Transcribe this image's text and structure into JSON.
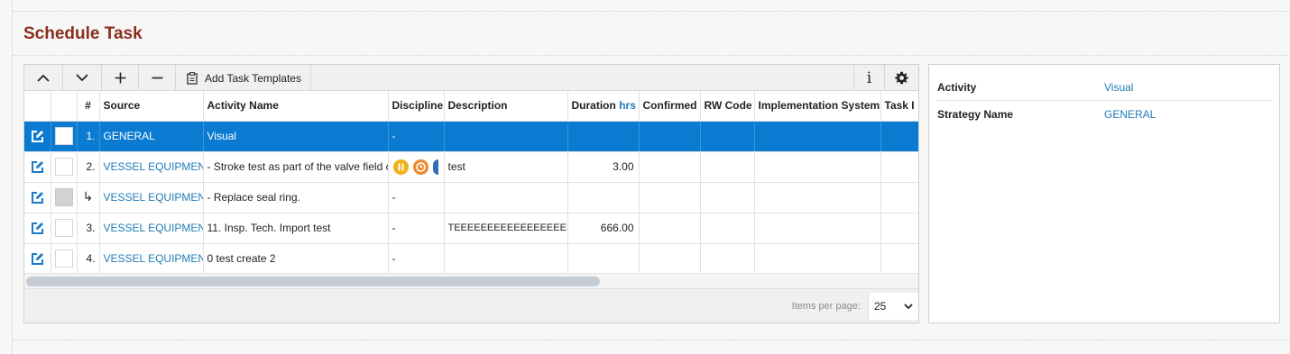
{
  "page": {
    "title": "Schedule Task"
  },
  "toolbar": {
    "add_task_templates_label": "Add Task Templates",
    "info_label": "i"
  },
  "grid": {
    "columns": {
      "num": "#",
      "source": "Source",
      "activity_name": "Activity Name",
      "discipline": "Discipline",
      "description": "Description",
      "duration": "Duration",
      "duration_unit": "hrs",
      "confirmed": "Confirmed",
      "rw_code": "RW Code",
      "implementation_system": "Implementation System",
      "task": "Task I"
    },
    "rows": [
      {
        "num": "1.",
        "source": "GENERAL",
        "activity_name": "Visual",
        "discipline": "-",
        "description": "",
        "duration": "",
        "selected": true
      },
      {
        "num": "2.",
        "source": "VESSEL EQUIPMENT",
        "activity_name": "- Stroke test as part of the valve field co",
        "discipline": "",
        "description": "test",
        "duration": "3.00"
      },
      {
        "num": "↳",
        "source": "VESSEL EQUIPMENT",
        "activity_name": "- Replace seal ring.",
        "discipline": "-",
        "description": "",
        "duration": ""
      },
      {
        "num": "3.",
        "source": "VESSEL EQUIPMENT",
        "activity_name": "11. Insp. Tech. Import test",
        "discipline": "-",
        "description": "TEEEEEEEEEEEEEEEEEST",
        "duration": "666.00"
      },
      {
        "num": "4.",
        "source": "VESSEL EQUIPMENT",
        "activity_name": "0 test create 2",
        "discipline": "-",
        "description": "",
        "duration": ""
      }
    ],
    "status_icons": {
      "pause_color": "#f0b21b",
      "clock_color": "#ec8a2f",
      "partial_color": "#2f6fb3"
    }
  },
  "pager": {
    "items_per_page_label": "Items per page:",
    "items_per_page_value": "25"
  },
  "detail": {
    "activity_label": "Activity",
    "activity_value": "Visual",
    "strategy_label": "Strategy Name",
    "strategy_value": "GENERAL"
  },
  "colors": {
    "title": "#8b2e1f",
    "accent": "#0a7bd0",
    "link": "#1f7bb6"
  }
}
